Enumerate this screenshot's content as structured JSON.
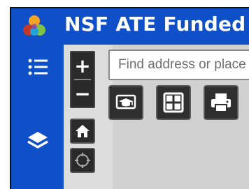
{
  "header": {
    "title": "NSF ATE Funded",
    "logo_icon": "hexagon-cubes-logo-icon",
    "background": "#0f4fc7"
  },
  "sidebar": {
    "items": [
      {
        "icon": "list-icon",
        "name": "legend"
      },
      {
        "icon": "layers-icon",
        "name": "layers"
      }
    ]
  },
  "map_controls": {
    "zoom_in_label": "+",
    "zoom_out_label": "−",
    "home_icon": "home-icon",
    "locate_icon": "locate-icon"
  },
  "search": {
    "placeholder": "Find address or place"
  },
  "toolbar": {
    "items": [
      {
        "icon": "graduation-cap-icon"
      },
      {
        "icon": "grid-icon"
      },
      {
        "icon": "print-icon"
      }
    ]
  }
}
